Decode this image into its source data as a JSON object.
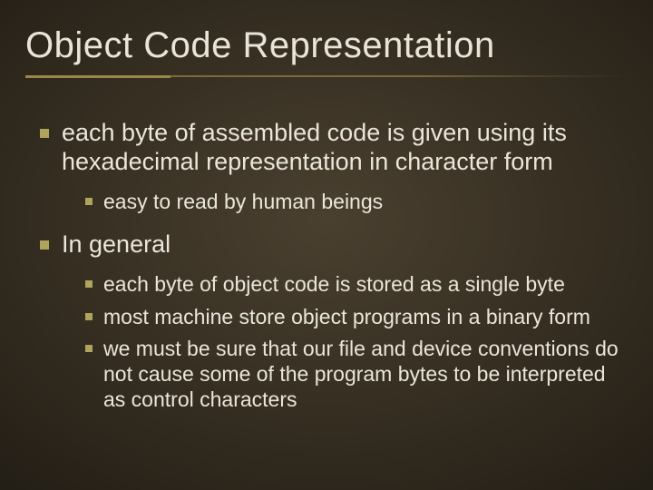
{
  "title": "Object Code Representation",
  "bullets": [
    {
      "text": "each byte of assembled code is given using its hexadecimal representation in character form",
      "children": [
        {
          "text": "easy to read by human beings"
        }
      ]
    },
    {
      "text": "In general",
      "children": [
        {
          "text": "each byte of object code is stored as a single byte"
        },
        {
          "text": "most machine store object programs in a binary form"
        },
        {
          "text": "we must be sure that our file and device conventions do not cause some of the program bytes to be interpreted as control characters"
        }
      ]
    }
  ]
}
